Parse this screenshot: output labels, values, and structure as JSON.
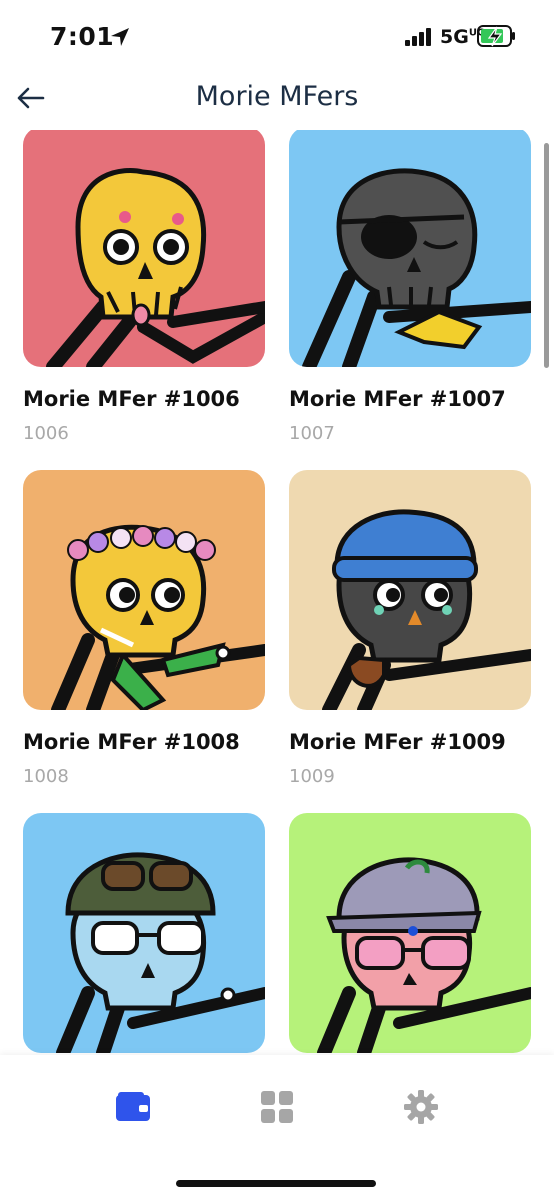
{
  "status_bar": {
    "time": "7:01",
    "network": "5G",
    "network_suffix": "UC"
  },
  "header": {
    "title": "Morie MFers"
  },
  "items": [
    {
      "name": "Morie MFer #1006",
      "id": "1006",
      "bg": "#e5717a"
    },
    {
      "name": "Morie MFer #1007",
      "id": "1007",
      "bg": "#7dc7f3"
    },
    {
      "name": "Morie MFer #1008",
      "id": "1008",
      "bg": "#f0b06d"
    },
    {
      "name": "Morie MFer #1009",
      "id": "1009",
      "bg": "#efd9b0"
    },
    {
      "name": "",
      "id": "",
      "bg": "#7dc7f3"
    },
    {
      "name": "",
      "id": "",
      "bg": "#b6f27a"
    }
  ],
  "tabs": [
    {
      "icon": "wallet-icon",
      "active": true
    },
    {
      "icon": "grid-icon",
      "active": false
    },
    {
      "icon": "gear-icon",
      "active": false
    }
  ],
  "colors": {
    "accent": "#2f54eb",
    "inactive_icon": "#a6a6a6",
    "title": "#1c2e44"
  }
}
